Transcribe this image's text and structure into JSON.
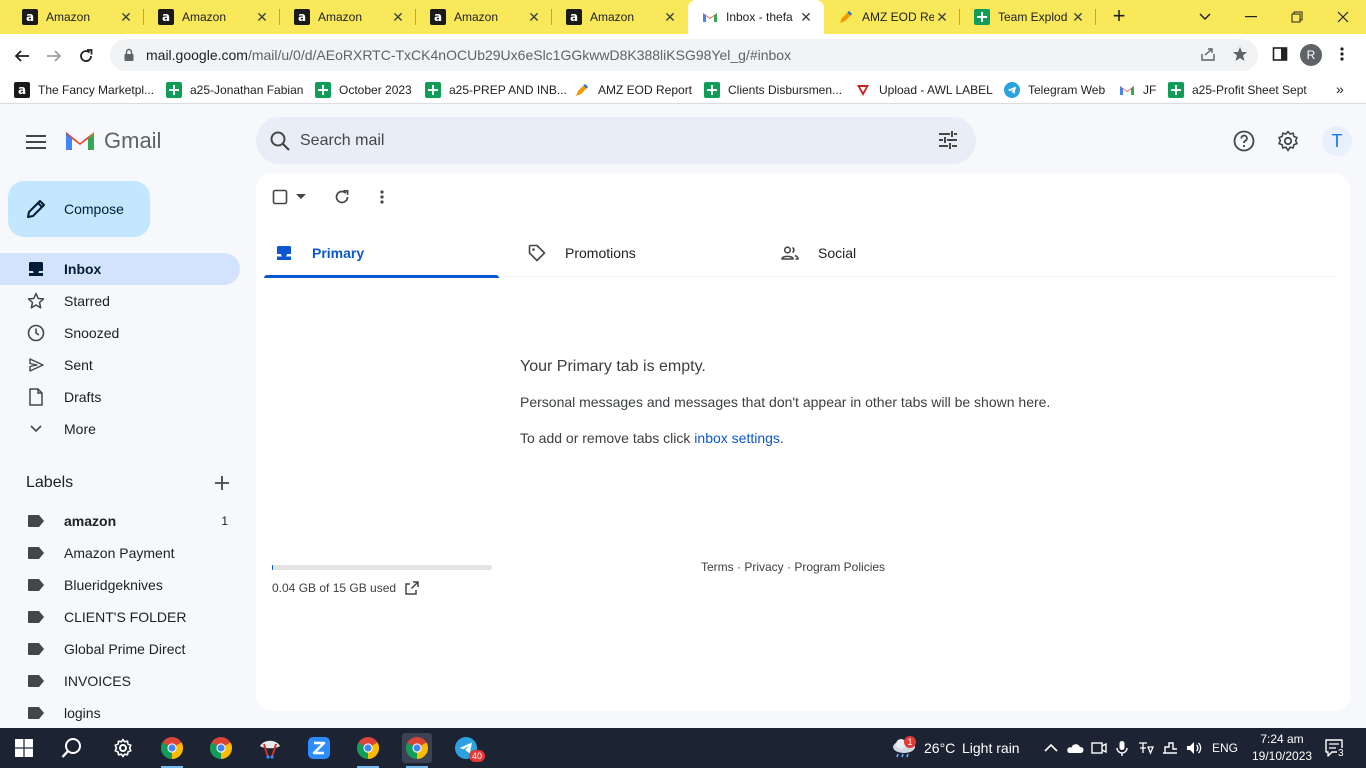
{
  "browser": {
    "tabs": [
      {
        "title": "Amazon",
        "favicon": "amazon-icon"
      },
      {
        "title": "Amazon",
        "favicon": "amazon-icon"
      },
      {
        "title": "Amazon",
        "favicon": "amazon-icon"
      },
      {
        "title": "Amazon",
        "favicon": "amazon-icon"
      },
      {
        "title": "Amazon",
        "favicon": "amazon-icon"
      },
      {
        "title": "Inbox - thefa",
        "favicon": "gmail-icon",
        "active": true
      },
      {
        "title": "AMZ EOD Re",
        "favicon": "pencil-app-icon"
      },
      {
        "title": "Team Explod",
        "favicon": "sheets-icon"
      }
    ],
    "url_host": "mail.google.com",
    "url_path": "/mail/u/0/d/AEoRXRTC-TxCK4nOCUb29Ux6eSlc1GGkwwD8K388liKSG98Yel_g/#inbox",
    "profile_initial": "R",
    "bookmarks": [
      {
        "label": "The Fancy Marketpl...",
        "icon": "amazon-icon"
      },
      {
        "label": "a25-Jonathan Fabian",
        "icon": "sheets-icon"
      },
      {
        "label": "October 2023",
        "icon": "sheets-icon"
      },
      {
        "label": "a25-PREP AND INB...",
        "icon": "sheets-icon"
      },
      {
        "label": "AMZ EOD Report",
        "icon": "pencil-app-icon"
      },
      {
        "label": "Clients Disbursmen...",
        "icon": "sheets-icon"
      },
      {
        "label": "Upload - AWL LABEL",
        "icon": "awl-icon"
      },
      {
        "label": "Telegram Web",
        "icon": "telegram-icon"
      },
      {
        "label": "JF",
        "icon": "gmail-icon"
      },
      {
        "label": "a25-Profit Sheet Sept",
        "icon": "sheets-icon"
      }
    ]
  },
  "gmail": {
    "brand": "Gmail",
    "search_placeholder": "Search mail",
    "account_initial": "T",
    "compose_label": "Compose",
    "nav": [
      {
        "label": "Inbox",
        "icon": "inbox-icon",
        "active": true
      },
      {
        "label": "Starred",
        "icon": "star-icon"
      },
      {
        "label": "Snoozed",
        "icon": "clock-icon"
      },
      {
        "label": "Sent",
        "icon": "send-icon"
      },
      {
        "label": "Drafts",
        "icon": "draft-icon"
      },
      {
        "label": "More",
        "icon": "chevron-down-icon"
      }
    ],
    "labels_header": "Labels",
    "labels": [
      {
        "label": "amazon",
        "count": "1",
        "bold": true
      },
      {
        "label": "Amazon Payment"
      },
      {
        "label": "Blueridgeknives"
      },
      {
        "label": "CLIENT'S FOLDER"
      },
      {
        "label": "Global Prime Direct"
      },
      {
        "label": "INVOICES"
      },
      {
        "label": "logins"
      }
    ],
    "category_tabs": [
      {
        "label": "Primary",
        "icon": "inbox-icon",
        "active": true
      },
      {
        "label": "Promotions",
        "icon": "tag-icon"
      },
      {
        "label": "Social",
        "icon": "people-icon"
      }
    ],
    "empty_title": "Your Primary tab is empty.",
    "empty_body": "Personal messages and messages that don't appear in other tabs will be shown here.",
    "empty_settings_prefix": "To add or remove tabs click ",
    "empty_settings_link": "inbox settings",
    "empty_settings_suffix": ".",
    "storage_text": "0.04 GB of 15 GB used",
    "storage_fraction": 0.0027,
    "footer": "Terms · Privacy · Program Policies",
    "accent_color": "#0b57d0"
  },
  "taskbar": {
    "weather_temp": "26°C",
    "weather_desc": "Light rain",
    "weather_badge": "1",
    "telegram_badge": "40",
    "language": "ENG",
    "time": "7:24 am",
    "date": "19/10/2023",
    "notifications": "3"
  }
}
